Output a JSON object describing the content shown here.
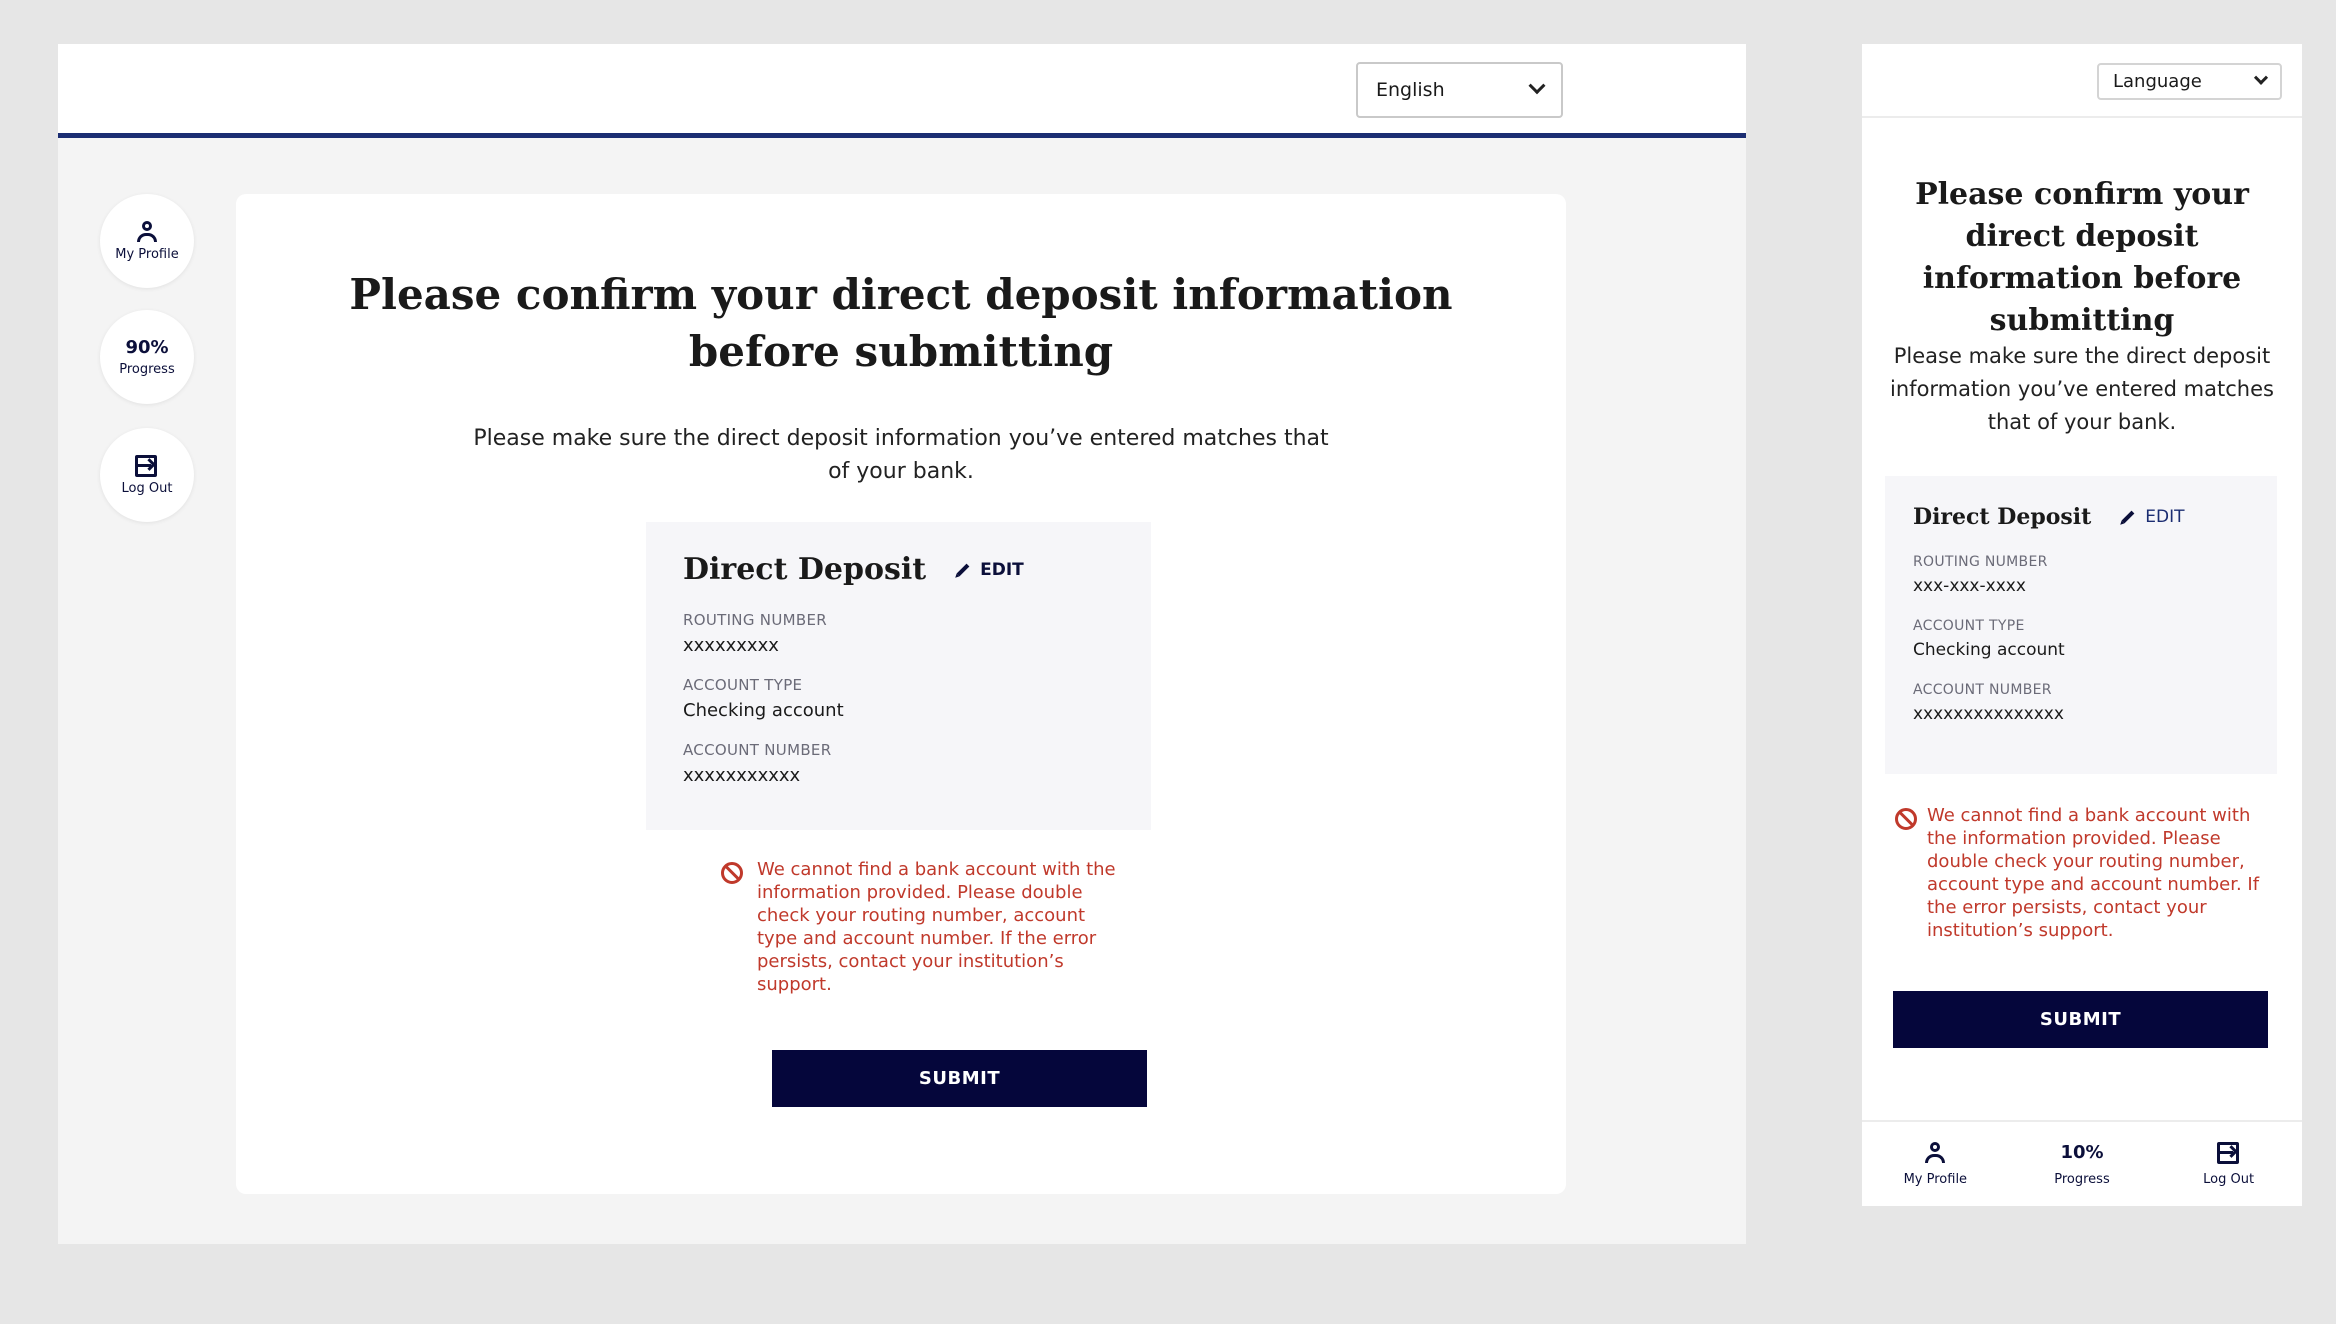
{
  "desktop": {
    "language_select": {
      "value": "English"
    },
    "sidebar": {
      "profile_label": "My Profile",
      "progress_value": "90%",
      "progress_label": "Progress",
      "logout_label": "Log Out"
    },
    "heading": "Please confirm your direct deposit information before submitting",
    "intro": "Please make sure the direct deposit information you’ve entered matches that of your bank.",
    "direct_deposit": {
      "title": "Direct Deposit",
      "edit_label": "EDIT",
      "routing_label": "ROUTING NUMBER",
      "routing_value": "xxxxxxxxx",
      "account_type_label": "ACCOUNT TYPE",
      "account_type_value": "Checking account",
      "account_number_label": "ACCOUNT NUMBER",
      "account_number_value": "xxxxxxxxxxx"
    },
    "error": "We cannot find a bank account with the information provided. Please double check your routing number,  account type and account number. If the error persists, contact your institution’s support.",
    "submit_label": "SUBMIT"
  },
  "mobile": {
    "language_select": {
      "value": "Language"
    },
    "heading": "Please confirm your direct deposit information before submitting",
    "intro": "Please make sure the direct deposit information you’ve entered matches that of your bank.",
    "direct_deposit": {
      "title": "Direct Deposit",
      "edit_label": "EDIT",
      "routing_label": "ROUTING NUMBER",
      "routing_value": "xxx-xxx-xxxx",
      "account_type_label": "ACCOUNT TYPE",
      "account_type_value": "Checking account",
      "account_number_label": "ACCOUNT NUMBER",
      "account_number_value": "xxxxxxxxxxxxxxx"
    },
    "error": "We cannot find a bank account with the information provided. Please double check your routing number, account type and account number. If the error persists, contact your institution’s support.",
    "submit_label": "SUBMIT",
    "bottom_nav": {
      "profile_label": "My Profile",
      "progress_value": "10%",
      "progress_label": "Progress",
      "logout_label": "Log Out"
    }
  },
  "colors": {
    "navy": "#05063b",
    "header_rule": "#1b2d72",
    "error": "#c0392b"
  }
}
